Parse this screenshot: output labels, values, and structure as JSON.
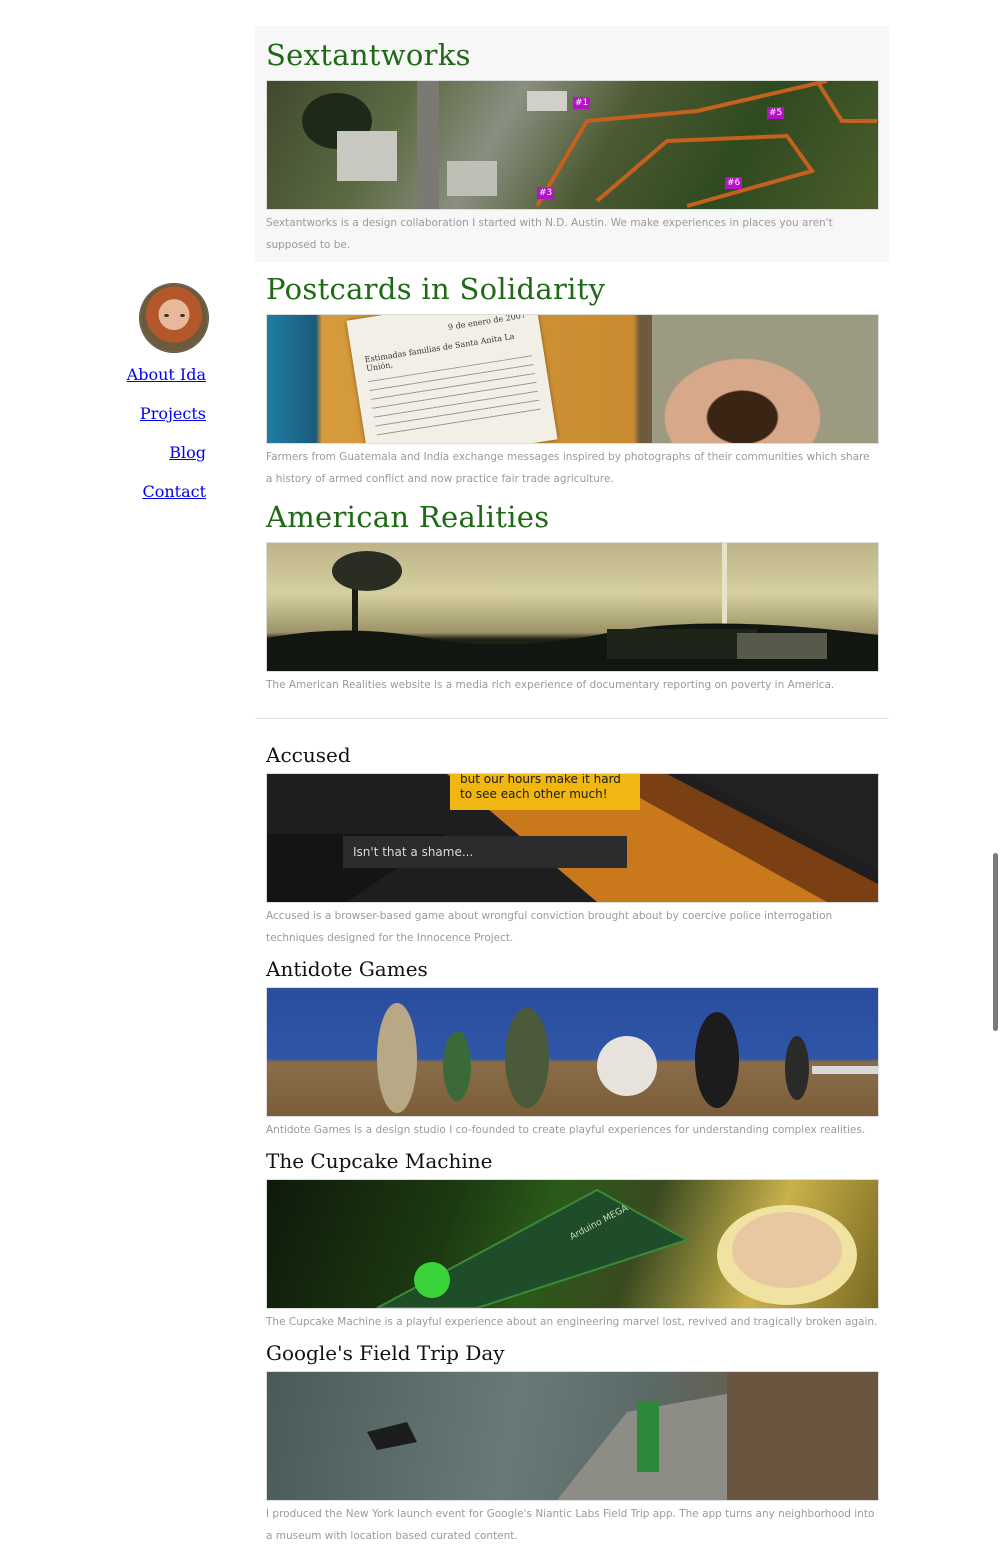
{
  "nav": {
    "items": [
      "About Ida",
      "Projects",
      "Blog",
      "Contact"
    ]
  },
  "featured": [
    {
      "title": "Sextantworks",
      "description": "Sextantworks is a design collaboration I started with N.D. Austin. We make experiences in places you aren't supposed to be.",
      "map_markers": [
        "#1",
        "#3",
        "#5",
        "#6"
      ]
    },
    {
      "title": "Postcards in Solidarity",
      "description": "Farmers from Guatemala and India exchange messages inspired by photographs of their communities which share a history of armed conflict and now practice fair trade agriculture.",
      "letter_date": "9 de enero de 2007",
      "letter_greeting": "Estimadas familias de Santa Anita La Unión,"
    },
    {
      "title": "American Realities",
      "description": "The American Realities website is a media rich experience of documentary reporting on poverty in America."
    }
  ],
  "projects": [
    {
      "title": "Accused",
      "description": "Accused is a browser-based game about wrongful conviction brought about by coercive police interrogation techniques designed for the Innocence Project.",
      "dialog_top": "but our hours make it hard to see each other much!",
      "dialog_reply": "Isn't that a shame..."
    },
    {
      "title": "Antidote Games",
      "description": "Antidote Games is a design studio I co-founded to create playful experiences for understanding complex realities."
    },
    {
      "title": "The Cupcake Machine",
      "description": "The Cupcake Machine is a playful experience about an engineering marvel lost, revived and tragically broken again.",
      "board_label": "Arduino MEGA"
    },
    {
      "title": "Google's Field Trip Day",
      "description": "I produced the New York launch event for Google's Niantic Labs Field Trip app. The app turns any neighborhood into a museum with location based curated content."
    }
  ]
}
